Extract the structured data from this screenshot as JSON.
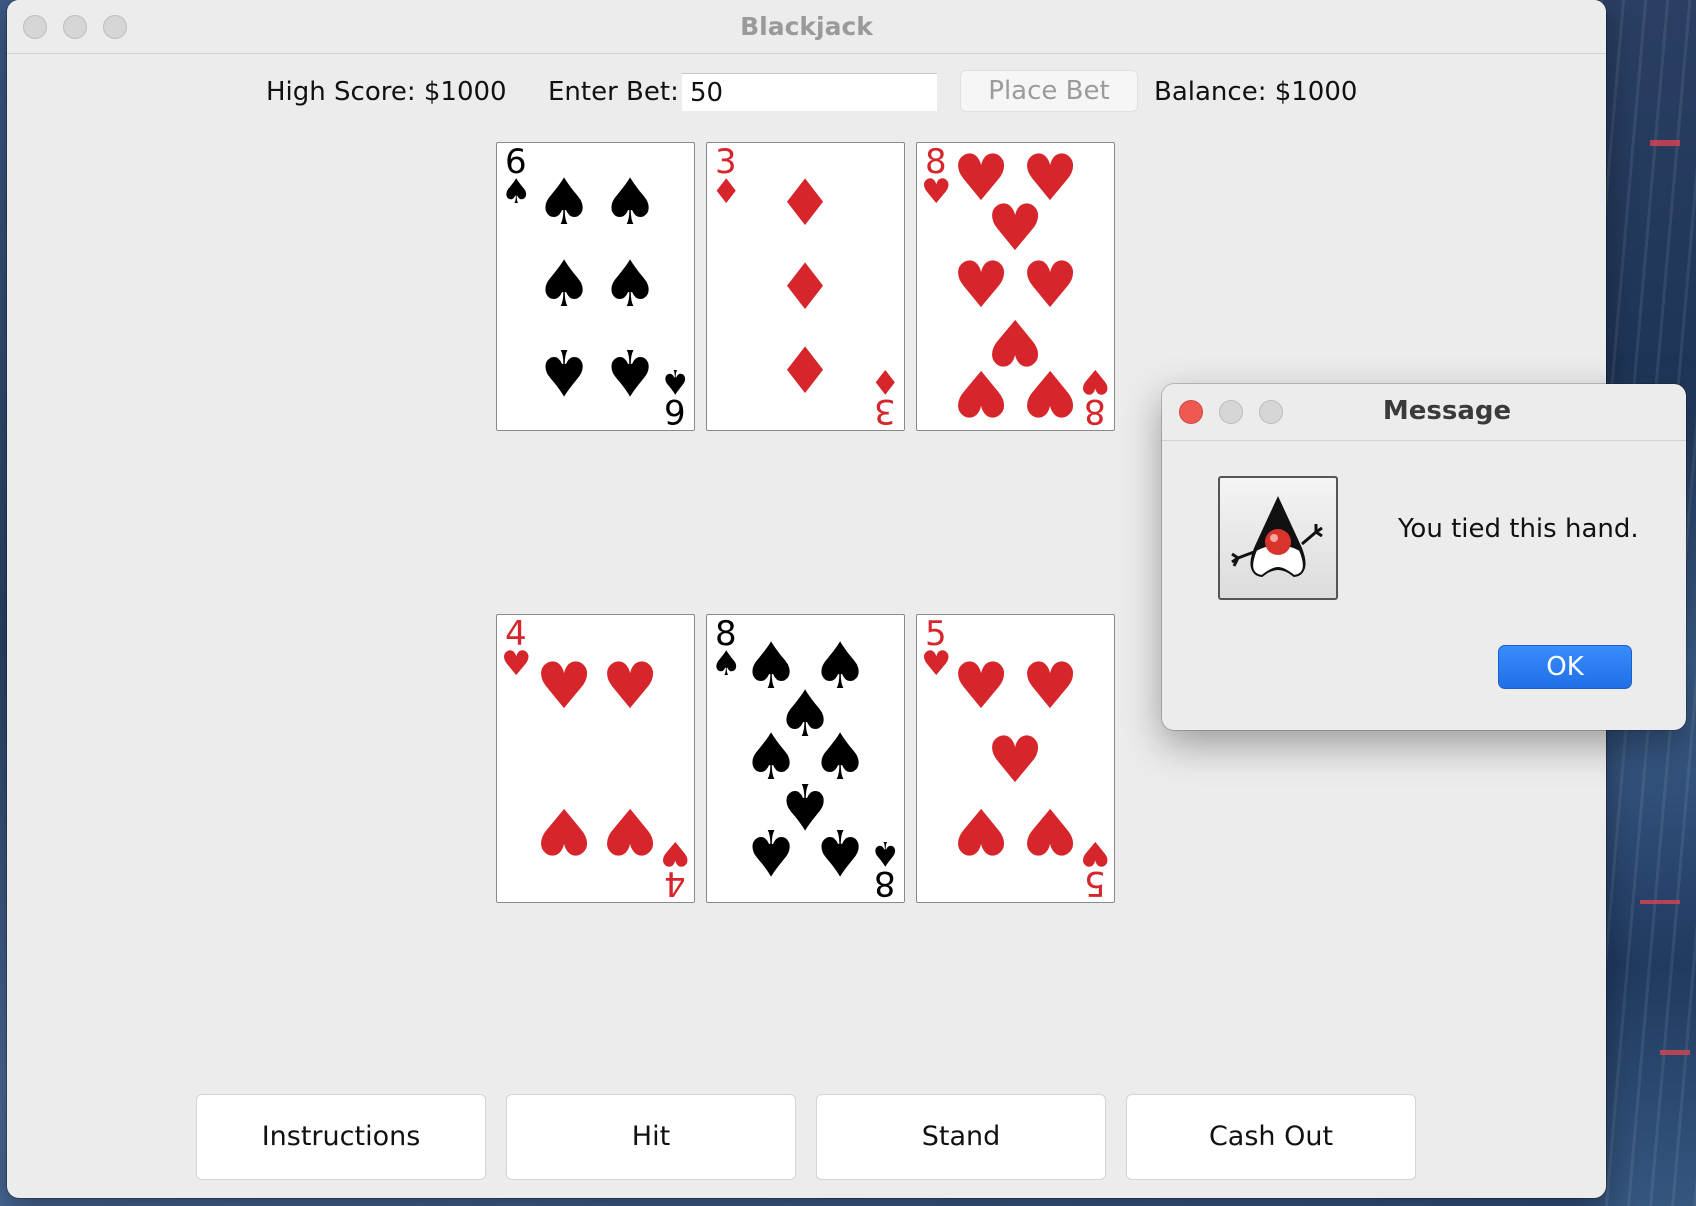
{
  "window": {
    "title": "Blackjack"
  },
  "header": {
    "high_score_label": "High Score: $1000",
    "bet_label": "Enter Bet:",
    "bet_value": "50",
    "place_bet_label": "Place Bet",
    "balance_label": "Balance: $1000"
  },
  "dealer_cards": [
    {
      "rank": "6",
      "suit": "♠",
      "color": "black"
    },
    {
      "rank": "3",
      "suit": "♦",
      "color": "red"
    },
    {
      "rank": "8",
      "suit": "♥",
      "color": "red"
    }
  ],
  "player_cards": [
    {
      "rank": "4",
      "suit": "♥",
      "color": "red"
    },
    {
      "rank": "8",
      "suit": "♠",
      "color": "black"
    },
    {
      "rank": "5",
      "suit": "♥",
      "color": "red"
    }
  ],
  "buttons": {
    "instructions": "Instructions",
    "hit": "Hit",
    "stand": "Stand",
    "cash_out": "Cash Out"
  },
  "dialog": {
    "title": "Message",
    "message": "You tied this hand.",
    "ok_label": "OK",
    "icon": "java-duke-icon"
  },
  "colors": {
    "red_suit": "#d6262b",
    "black_suit": "#000000",
    "ok_button": "#2a7ef5",
    "close_light": "#ee5a52"
  }
}
